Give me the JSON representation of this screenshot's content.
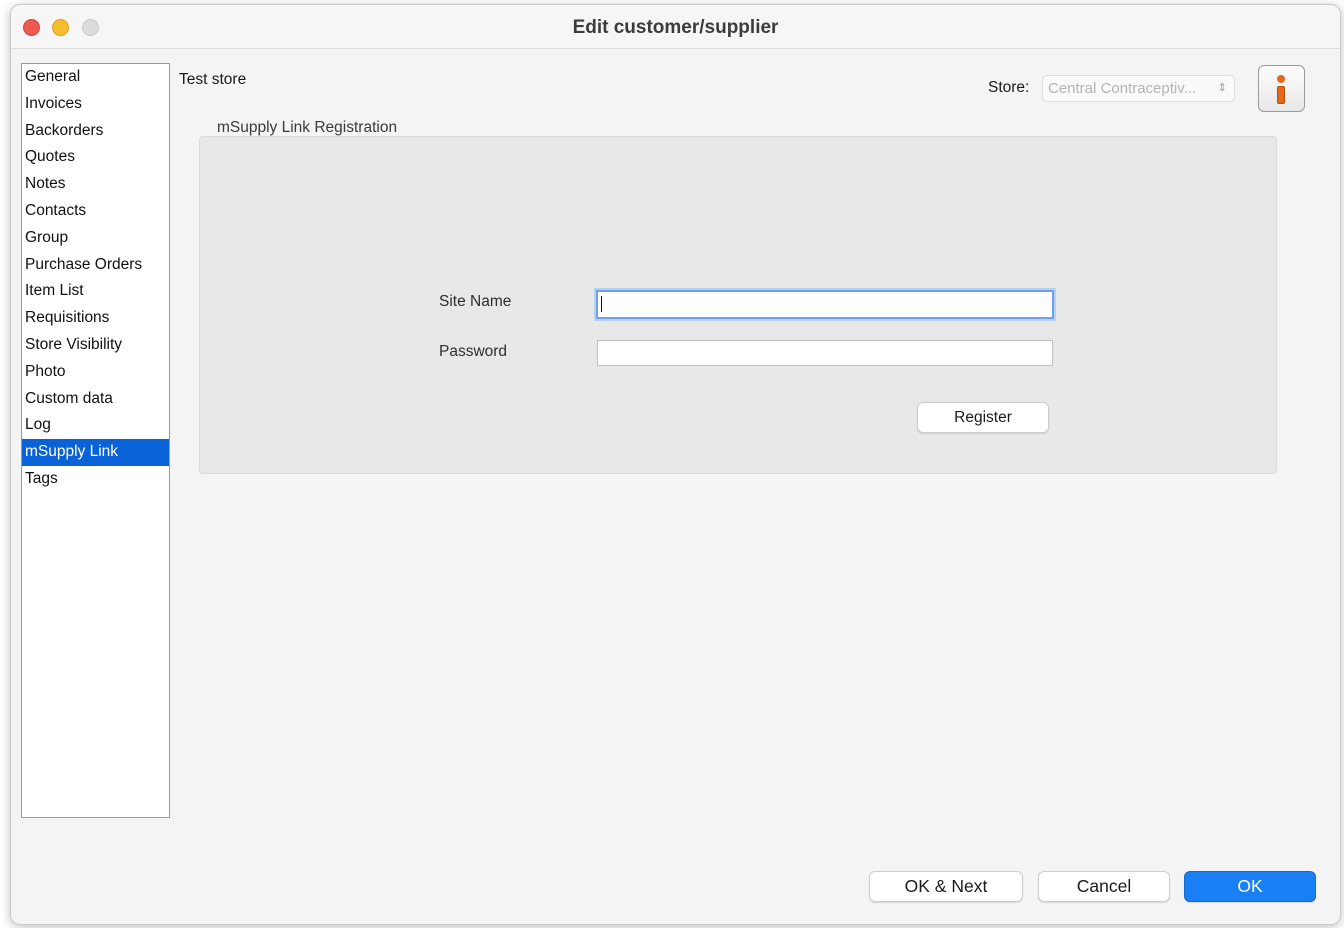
{
  "window": {
    "title": "Edit customer/supplier"
  },
  "sidebar": {
    "items": [
      {
        "label": "General"
      },
      {
        "label": "Invoices"
      },
      {
        "label": "Backorders"
      },
      {
        "label": "Quotes"
      },
      {
        "label": "Notes"
      },
      {
        "label": "Contacts"
      },
      {
        "label": "Group"
      },
      {
        "label": "Purchase Orders"
      },
      {
        "label": "Item List"
      },
      {
        "label": "Requisitions"
      },
      {
        "label": "Store Visibility"
      },
      {
        "label": "Photo"
      },
      {
        "label": "Custom data"
      },
      {
        "label": "Log"
      },
      {
        "label": "mSupply Link",
        "selected": true
      },
      {
        "label": "Tags"
      }
    ]
  },
  "header": {
    "store_name": "Test store",
    "store_label": "Store:",
    "store_select_value": "Central Contraceptiv...",
    "info_icon": "info-icon"
  },
  "registration": {
    "group_label": "mSupply Link Registration",
    "site_name_label": "Site Name",
    "site_name_value": "",
    "password_label": "Password",
    "password_value": "",
    "register_label": "Register"
  },
  "footer": {
    "ok_next_label": "OK & Next",
    "cancel_label": "Cancel",
    "ok_label": "OK"
  },
  "colors": {
    "selection": "#0a62d9",
    "primary_button": "#1a7ff5",
    "info_icon": "#e36a1d"
  }
}
